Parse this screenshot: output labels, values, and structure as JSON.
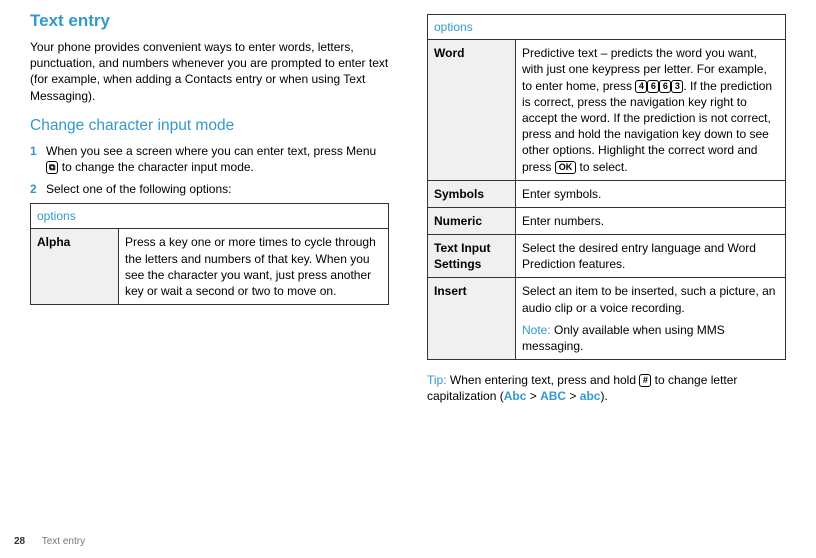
{
  "page": {
    "number": "28",
    "section": "Text entry",
    "title": "Text entry",
    "intro": "Your phone provides convenient ways to enter words, letters, punctuation, and numbers whenever you are prompted to enter text (for example, when adding a Contacts entry or when using Text Messaging).",
    "subhead": "Change character input mode",
    "steps": [
      {
        "num": "1",
        "text_before": "When you see a screen where you can enter text, press Menu ",
        "key": "⧉",
        "text_after": " to change the character input mode."
      },
      {
        "num": "2",
        "text_before": "Select one of the following options:"
      }
    ]
  },
  "left_table": {
    "header": "options",
    "rows": [
      {
        "label": "Alpha",
        "desc": "Press a key one or more times to cycle through the letters and numbers of that key. When you see the character you want, just press another key or wait a second or two to move on."
      }
    ]
  },
  "right_table": {
    "header": "options",
    "rows": {
      "word": {
        "label": "Word",
        "desc_part1": "Predictive text – predicts the word you want, with just one keypress per letter. For example, to enter home, press ",
        "keys": [
          "4",
          "6",
          "6",
          "3"
        ],
        "desc_part2": ". If the prediction is correct, press the navigation key right to accept the word. If the prediction is not correct, press and hold the navigation key down to see other options. Highlight the correct word and press ",
        "ok_key": "OK",
        "desc_part3": " to select."
      },
      "symbols": {
        "label": "Symbols",
        "desc": "Enter symbols."
      },
      "numeric": {
        "label": "Numeric",
        "desc": "Enter numbers."
      },
      "settings": {
        "label": "Text Input Settings",
        "desc": "Select the desired entry language and Word Prediction features."
      },
      "insert": {
        "label": "Insert",
        "desc": "Select an item to be inserted, such a picture, an audio clip or a voice recording.",
        "note_label": "Note:",
        "note_text": " Only available when using MMS messaging."
      }
    }
  },
  "tip": {
    "label": "Tip:",
    "part1": " When entering text, press and hold ",
    "key": "#",
    "part2": " to change letter capitalization (",
    "cap1": "Abc",
    "gt1": " > ",
    "cap2": "ABC",
    "gt2": " > ",
    "cap3": "abc",
    "part3": ")."
  }
}
